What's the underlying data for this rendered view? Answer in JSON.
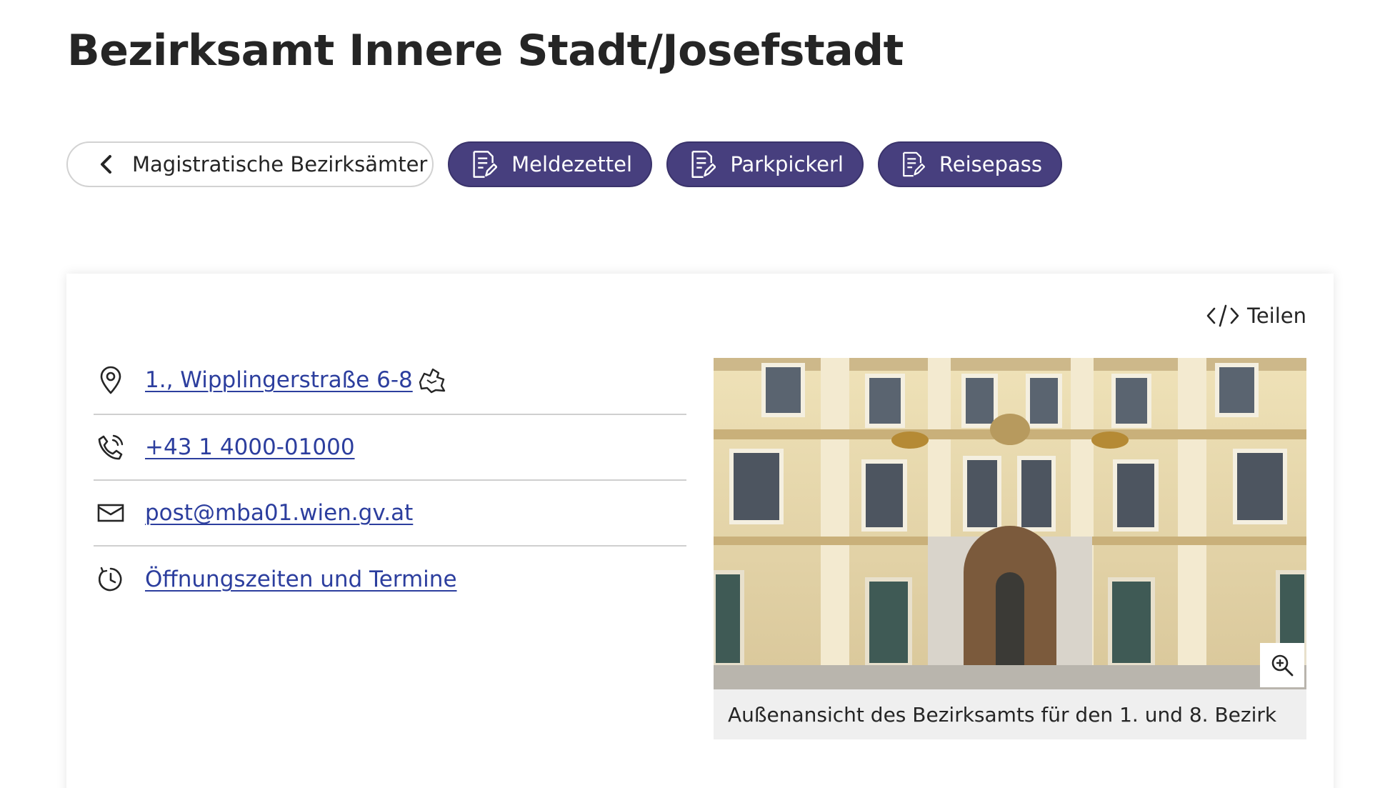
{
  "page": {
    "title": "Bezirksamt Innere Stadt/Josefstadt"
  },
  "nav": {
    "back_label": "Magistratische Bezirksämter",
    "services": [
      {
        "label": "Meldezettel",
        "icon": "document-edit-icon"
      },
      {
        "label": "Parkpickerl",
        "icon": "document-edit-icon"
      },
      {
        "label": "Reisepass",
        "icon": "document-edit-icon"
      }
    ]
  },
  "card": {
    "share_label": "Teilen",
    "contact": {
      "address": "1., Wipplingerstraße 6-8",
      "phone": "+43 1 4000-01000",
      "email": "post@mba01.wien.gv.at",
      "hours": "Öffnungszeiten und Termine"
    },
    "image": {
      "caption": "Außenansicht des Bezirksamts für den 1. und 8. Bezirk"
    }
  },
  "colors": {
    "primary": "#473f7e",
    "link": "#2c3e9e",
    "text": "#252525",
    "divider": "#cfcfcf",
    "caption_bg": "#efefef"
  }
}
